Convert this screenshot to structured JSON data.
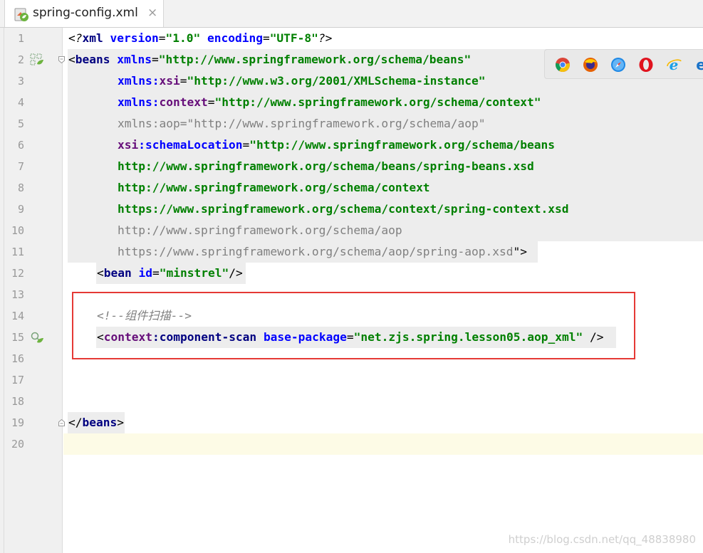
{
  "tab": {
    "label": "spring-config.xml",
    "close": "×",
    "icon": "spring-xml-file-icon"
  },
  "line_numbers": [
    "1",
    "2",
    "3",
    "4",
    "5",
    "6",
    "7",
    "8",
    "9",
    "10",
    "11",
    "12",
    "13",
    "14",
    "15",
    "16",
    "17",
    "18",
    "19",
    "20"
  ],
  "code": {
    "l1": {
      "a": "<?",
      "b": "xml",
      "c": " ",
      "d": "version",
      "e": "=",
      "f": "\"1.0\"",
      "g": " ",
      "h": "encoding",
      "i": "=",
      "j": "\"UTF-8\"",
      "k": "?>"
    },
    "l2": {
      "a": "<",
      "b": "beans",
      "c": " ",
      "d": "xmlns",
      "e": "=",
      "f": "\"http://www.springframework.org/schema/beans\""
    },
    "l3": {
      "a": "xmlns",
      "b": ":",
      "c": "xsi",
      "d": "=",
      "e": "\"http://www.w3.org/2001/XMLSchema-instance\""
    },
    "l4": {
      "a": "xmlns",
      "b": ":",
      "c": "context",
      "d": "=",
      "e": "\"http://www.springframework.org/schema/context\""
    },
    "l5": {
      "a": "xmlns:aop=\"http://www.springframework.org/schema/aop\""
    },
    "l6": {
      "a": "xsi",
      "b": ":",
      "c": "schemaLocation",
      "d": "=",
      "e": "\"http://www.springframework.org/schema/beans"
    },
    "l7": {
      "a": "http://www.springframework.org/schema/beans/spring-beans.xsd"
    },
    "l8": {
      "a": "http://www.springframework.org/schema/context"
    },
    "l9": {
      "a": "https://www.springframework.org/schema/context/spring-context.xsd"
    },
    "l10": {
      "a": "http://www.springframework.org/schema/aop"
    },
    "l11": {
      "a": "https://www.springframework.org/schema/aop/spring-aop.xsd",
      "b": "\">"
    },
    "l12": {
      "a": "<",
      "b": "bean",
      "c": " ",
      "d": "id",
      "e": "=",
      "f": "\"minstrel\"",
      "g": "/>"
    },
    "l14": {
      "a": "<!--组件扫描-->"
    },
    "l15": {
      "a": "<",
      "b": "context",
      "c": ":",
      "d": "component-scan",
      "e": " ",
      "f": "base-package",
      "g": "=",
      "h": "\"net.zjs.spring.lesson05.aop_xml\"",
      "i": " />"
    },
    "l19": {
      "a": "</",
      "b": "beans",
      "c": ">"
    }
  },
  "browser_icons": [
    "chrome-icon",
    "firefox-icon",
    "safari-icon",
    "opera-icon",
    "ie-icon",
    "edge-icon"
  ],
  "watermark": "https://blog.csdn.net/qq_48838980",
  "colors": {
    "tag": "#000080",
    "attr": "#0000ff",
    "namespace": "#660e7a",
    "string": "#008000",
    "comment": "#808080",
    "highlight_box": "#e53935"
  }
}
